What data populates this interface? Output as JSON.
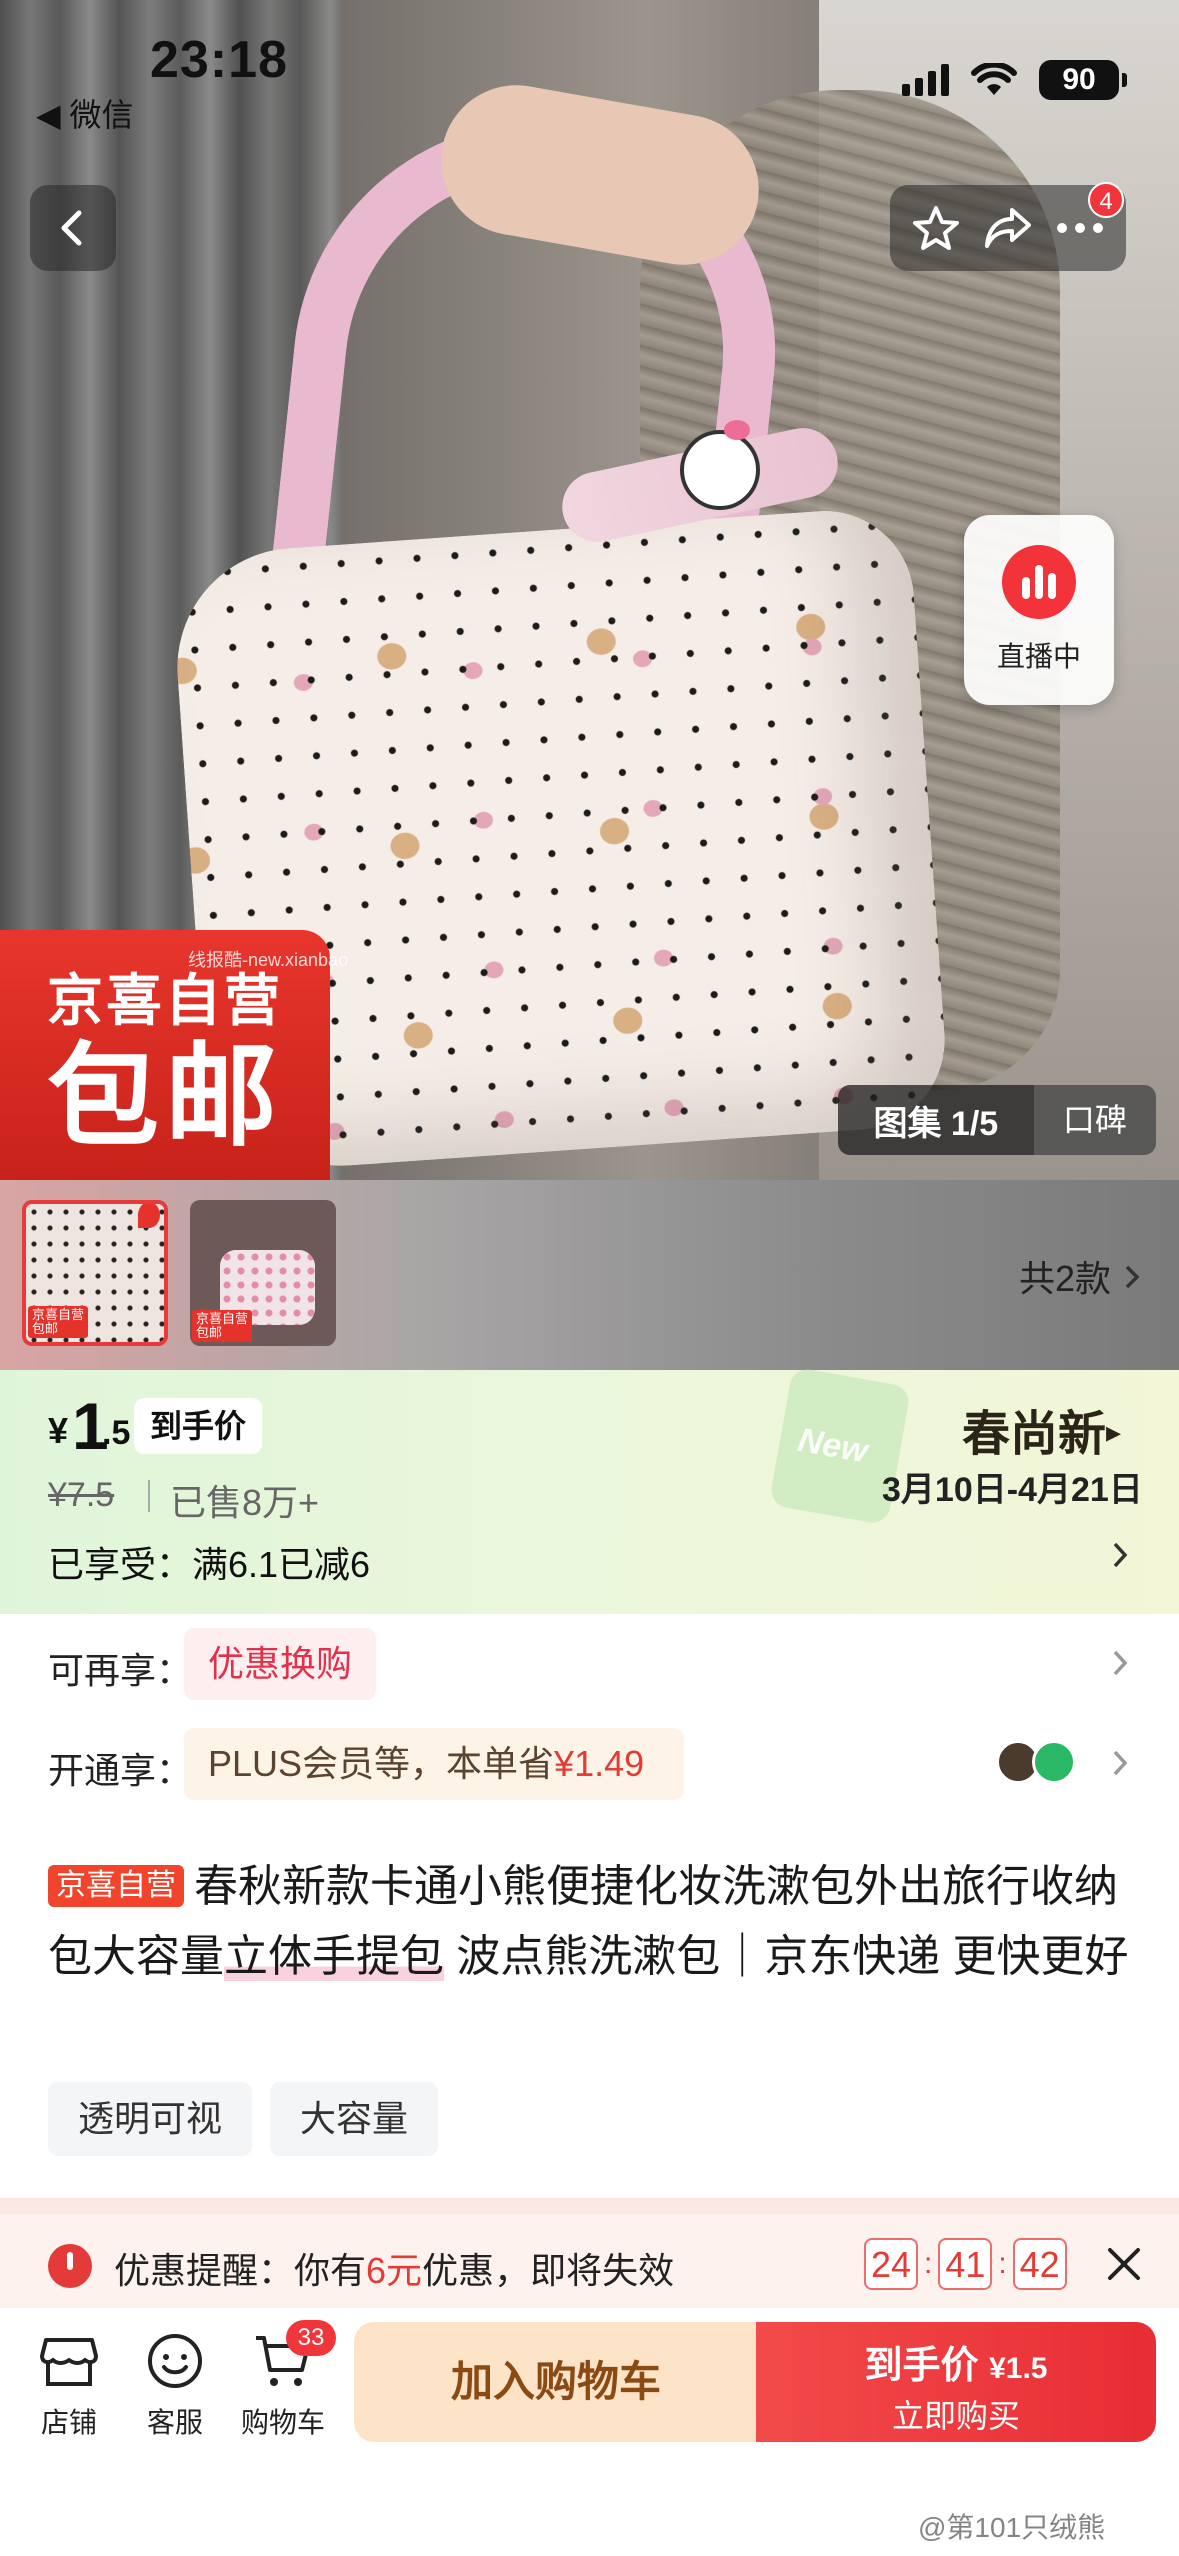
{
  "status_bar": {
    "time": "23:18",
    "back_app": "◀ 微信",
    "battery": "90"
  },
  "top_nav": {
    "message_badge": "4"
  },
  "live": {
    "label": "直播中"
  },
  "promo": {
    "line1": "京喜自营",
    "line2": "包邮",
    "watermark": "线报酷-new.xianbao"
  },
  "gallery": {
    "counter": "图集 1/5",
    "reviews": "口碑"
  },
  "thumbnails": {
    "mini_tag": "京喜自营",
    "mini_tag2": "包邮",
    "variants": "共2款"
  },
  "price": {
    "currency": "¥",
    "int": "1",
    "decimal": ".5",
    "tag": "到手价",
    "original": "¥7.5",
    "sold": "已售8万+",
    "enjoyed": "已享受：满6.1已减6",
    "new_badge": "New",
    "season": "春尚新",
    "season_arrow": "▸",
    "season_dates": "3月10日-4月21日"
  },
  "rows": {
    "reenjoy_label": "可再享：",
    "reenjoy_chip": "优惠换购",
    "open_label": "开通享：",
    "plus_chip": "PLUS会员等，本单省",
    "plus_amount": "¥1.49"
  },
  "title": {
    "store_tag": "京喜自营",
    "text_a": "春秋新款卡通小熊便捷化妆洗漱包外出旅行收纳包大容量",
    "text_hl": "立体手提包",
    "text_b": " 波点熊洗漱包｜京东快递 更快更好"
  },
  "tags": [
    "透明可视",
    "大容量"
  ],
  "reminder": {
    "label": "优惠提醒：",
    "pre": "你有",
    "amount": "6元",
    "post": "优惠，即将失效",
    "h": "24",
    "m": "41",
    "s": "42",
    "sep": ":"
  },
  "bottom": {
    "shop": "店铺",
    "service": "客服",
    "cart": "购物车",
    "cart_count": "33",
    "add_cart": "加入购物车",
    "buy_line1_label": "到手价",
    "buy_line1_price": "¥1.5",
    "buy_line2": "立即购买"
  },
  "watermark_weibo": "@第101只绒熊",
  "colors": {
    "accent_red": "#e43b34",
    "price_panel_green": "#dff5d9",
    "add_cart_bg": "#fde4c8"
  }
}
